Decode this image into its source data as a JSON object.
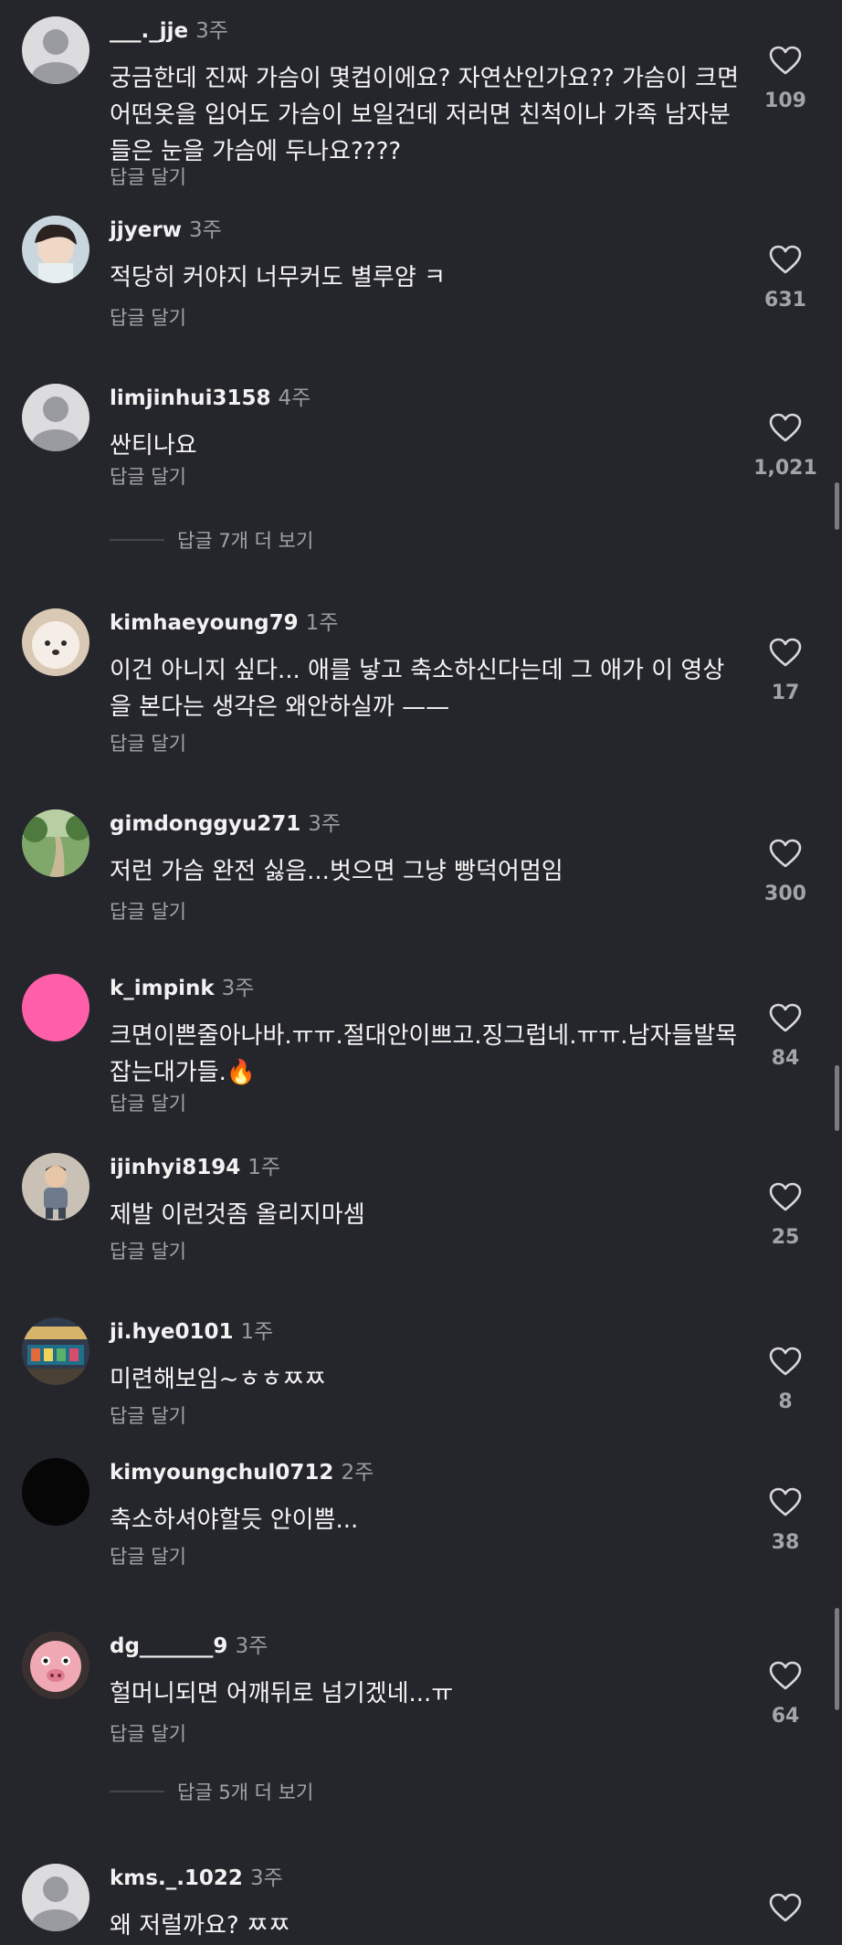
{
  "colors": {
    "background": "#25262b",
    "secondary_text": "#a3a4aa",
    "username": "#f2f2f2"
  },
  "icons": {
    "like": "heart-outline-icon"
  },
  "comments": [
    {
      "username": "___._jje",
      "time": "3주",
      "text": "궁금한데 진짜 가슴이 몇컵이에요? 자연산인가요?? 가슴이 크면 어떤옷을 입어도 가슴이 보일건데 저러면 친척이나 가족 남자분들은 눈을 가슴에 두나요????",
      "reply_label": "답글 달기",
      "likes": "109",
      "avatar": "default"
    },
    {
      "username": "jjyerw",
      "time": "3주",
      "text": "적당히 커야지 너무커도 별루얌 ㅋ",
      "reply_label": "답글 달기",
      "likes": "631",
      "avatar": "photo-girl"
    },
    {
      "username": "limjinhui3158",
      "time": "4주",
      "text": "싼티나요",
      "reply_label": "답글 달기",
      "likes": "1,021",
      "avatar": "default"
    },
    {
      "username": "kimhaeyoung79",
      "time": "1주",
      "text": "이건 아니지 싶다... 애를 낳고 축소하신다는데 그 애가 이 영상을 본다는 생각은 왜안하실까 ——",
      "reply_label": "답글 달기",
      "likes": "17",
      "avatar": "photo-dog"
    },
    {
      "username": "gimdonggyu271",
      "time": "3주",
      "text": "저런 가슴 완전 싫음...벗으면 그냥 빵덕어멈임",
      "reply_label": "답글 달기",
      "likes": "300",
      "avatar": "photo-park"
    },
    {
      "username": "k_impink",
      "time": "3주",
      "text": "크면이쁜줄아나바.ㅠㅠ.절대안이쁘고.징그럽네.ㅠㅠ.남자들발목잡는대가들.🔥",
      "reply_label": "답글 달기",
      "likes": "84",
      "avatar": "pink"
    },
    {
      "username": "ijinhyi8194",
      "time": "1주",
      "text": "제발 이런것좀 올리지마셈",
      "reply_label": "답글 달기",
      "likes": "25",
      "avatar": "photo-kid"
    },
    {
      "username": "ji.hye0101",
      "time": "1주",
      "text": "미련해보임~ㅎㅎㅉㅉ",
      "reply_label": "답글 달기",
      "likes": "8",
      "avatar": "photo-shop"
    },
    {
      "username": "kimyoungchul0712",
      "time": "2주",
      "text": "축소하셔야할듯 안이쁨...",
      "reply_label": "답글 달기",
      "likes": "38",
      "avatar": "black"
    },
    {
      "username": "dg_______9",
      "time": "3주",
      "text": "헐머니되면 어깨뒤로 넘기겠네...ㅠ",
      "reply_label": "답글 달기",
      "likes": "64",
      "avatar": "photo-pig"
    },
    {
      "username": "kms._.1022",
      "time": "3주",
      "text": "왜 저럴까요? ㅉㅉ",
      "reply_label": "답글 달기",
      "likes": "",
      "avatar": "default"
    }
  ],
  "more_replies": [
    {
      "label": "답글 7개 더 보기"
    },
    {
      "label": "답글 5개 더 보기"
    }
  ]
}
